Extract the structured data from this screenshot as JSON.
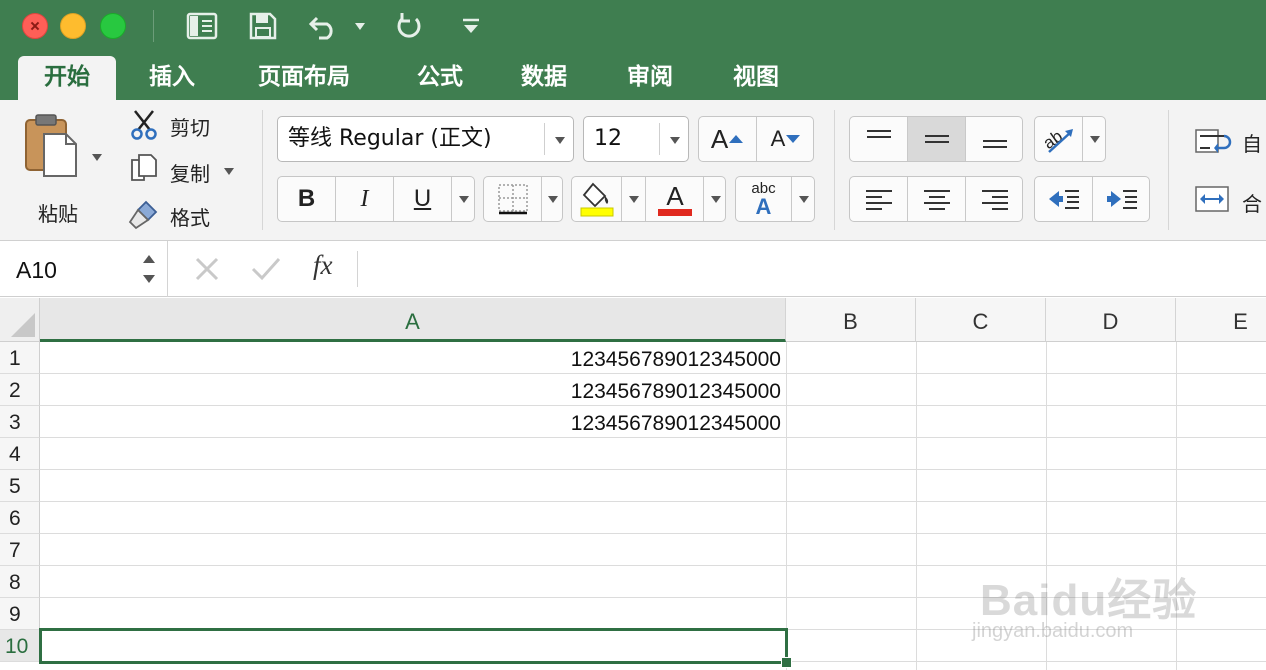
{
  "window": {
    "controls": [
      "close",
      "minimize",
      "zoom"
    ]
  },
  "quick_access": {
    "icons": [
      "sidebar-icon",
      "save-icon",
      "undo-icon",
      "redo-icon",
      "customize-icon"
    ]
  },
  "tabs": [
    {
      "label": "开始",
      "active": true
    },
    {
      "label": "插入"
    },
    {
      "label": "页面布局"
    },
    {
      "label": "公式"
    },
    {
      "label": "数据"
    },
    {
      "label": "审阅"
    },
    {
      "label": "视图"
    }
  ],
  "ribbon": {
    "clipboard": {
      "paste_label": "粘贴",
      "cut_label": "剪切",
      "copy_label": "复制",
      "format_label": "格式"
    },
    "font": {
      "name": "等线 Regular (正文)",
      "size": "12",
      "bold": "B",
      "italic": "I",
      "underline": "U",
      "grow": "A",
      "shrink": "A",
      "fill_color": "#ffff00",
      "font_color": "#e0291f",
      "abc_label": "abc",
      "abc_sub": "A"
    },
    "align": {
      "wrap_label": "自",
      "merge_label": "合"
    }
  },
  "formula_bar": {
    "cell_ref": "A10",
    "fx_label": "fx",
    "content": ""
  },
  "sheet": {
    "columns": [
      "A",
      "B",
      "C",
      "D",
      "E"
    ],
    "selected_column": "A",
    "rows": [
      "1",
      "2",
      "3",
      "4",
      "5",
      "6",
      "7",
      "8",
      "9",
      "10"
    ],
    "selected_row": "10",
    "cells": {
      "A1": "123456789012345000",
      "A2": "123456789012345000",
      "A3": "123456789012345000"
    }
  },
  "watermark": {
    "brand": "Baidu经验",
    "url": "jingyan.baidu.com"
  },
  "colors": {
    "accent": "#3f7e50",
    "selection": "#2f6f43"
  }
}
